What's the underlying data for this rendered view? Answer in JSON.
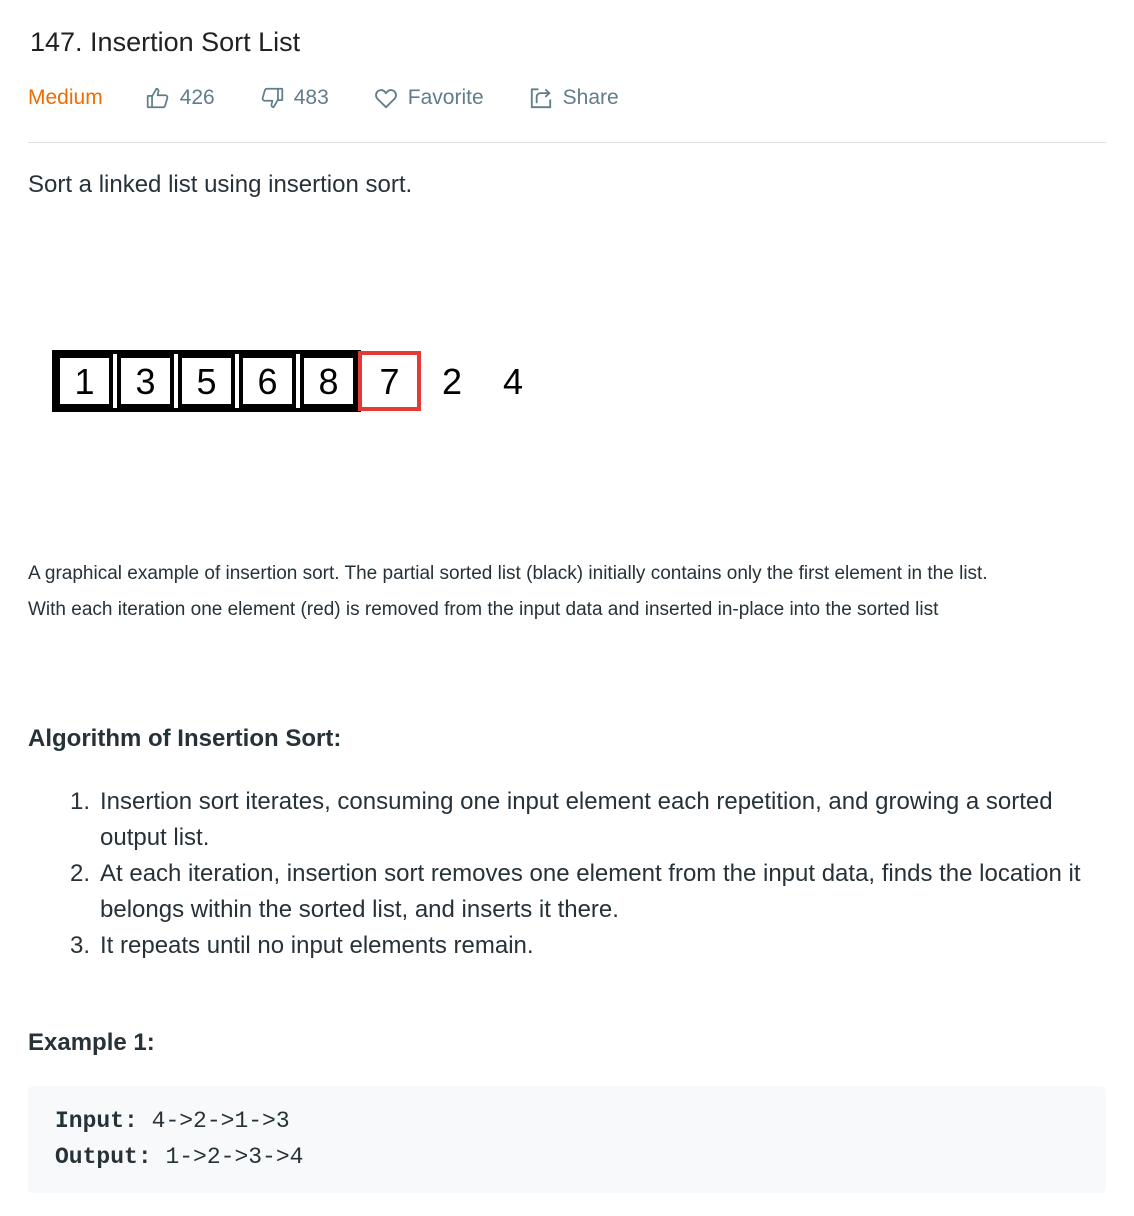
{
  "problem": {
    "title": "147. Insertion Sort List",
    "difficulty": "Medium",
    "likes": "426",
    "dislikes": "483",
    "favorite_label": "Favorite",
    "share_label": "Share"
  },
  "description": "Sort a linked list using insertion sort.",
  "figure": {
    "sorted_values": [
      "1",
      "3",
      "5",
      "6",
      "8"
    ],
    "current_value": "7",
    "remaining_values": [
      "2",
      "4"
    ],
    "sorted_color": "#000000",
    "current_color": "#e53935"
  },
  "caption": {
    "line1": "A graphical example of insertion sort. The partial sorted list (black) initially contains only the first element in the list.",
    "line2": "With each iteration one element (red) is removed from the input data and inserted in-place into the sorted list"
  },
  "algorithm": {
    "title": "Algorithm of Insertion Sort:",
    "steps": [
      {
        "num": "1.",
        "text": "Insertion sort iterates, consuming one input element each repetition, and growing a sorted output list."
      },
      {
        "num": "2.",
        "text": "At each iteration, insertion sort removes one element from the input data, finds the location it belongs within the sorted list, and inserts it there."
      },
      {
        "num": "3.",
        "text": "It repeats until no input elements remain."
      }
    ]
  },
  "example": {
    "title": "Example 1:",
    "input_label": "Input:",
    "input_value": "4->2->1->3",
    "output_label": "Output:",
    "output_value": "1->2->3->4"
  },
  "colors": {
    "difficulty": "#ef6c00",
    "meta_text": "#607d8b",
    "divider": "#e0e0e0",
    "code_bg": "#f7f9fa"
  }
}
